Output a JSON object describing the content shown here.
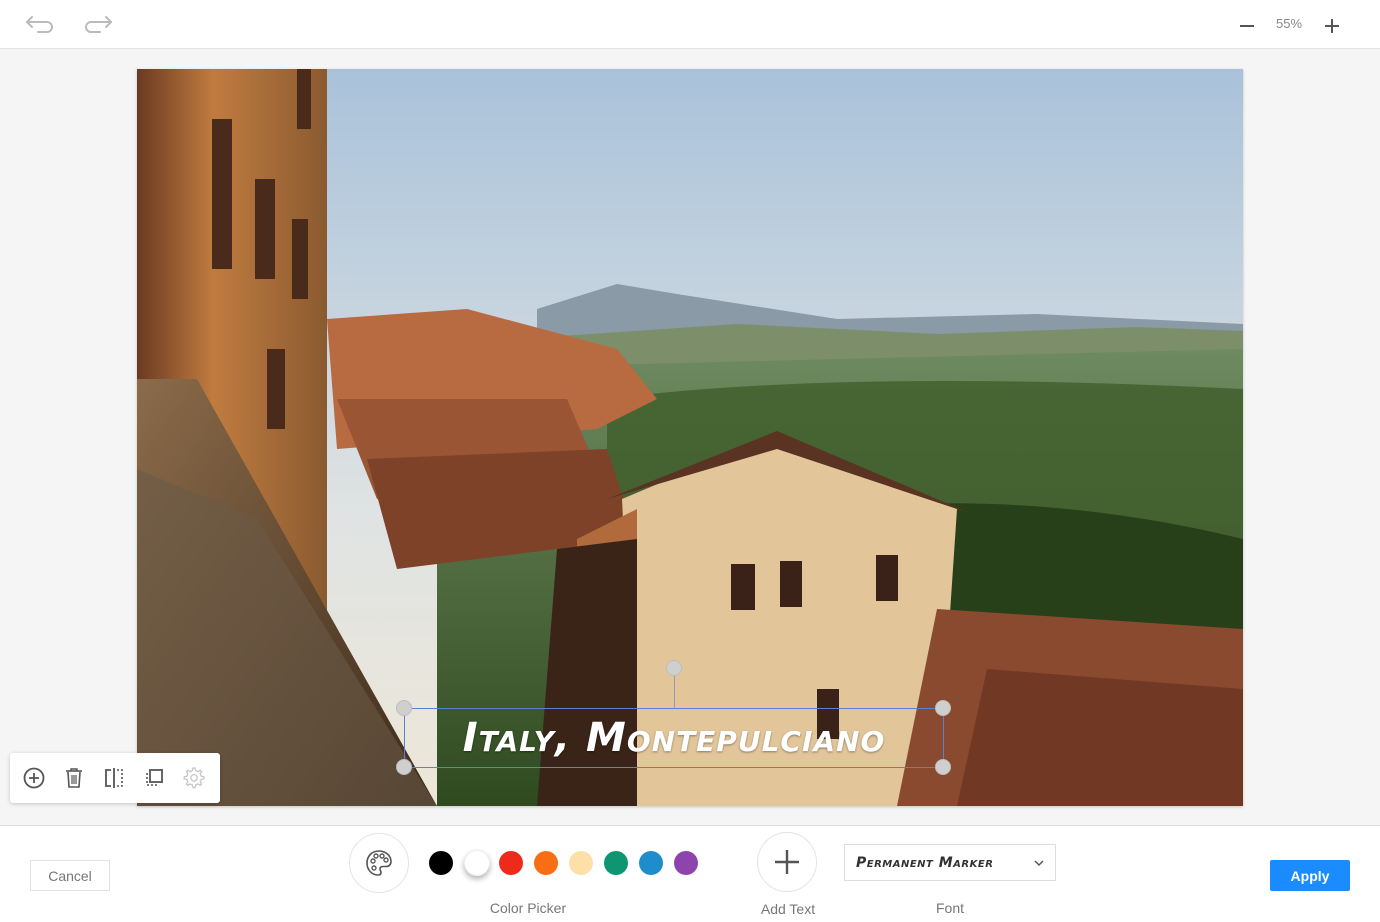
{
  "topbar": {
    "undo_icon": "undo-icon",
    "redo_icon": "redo-icon",
    "zoom_out_icon": "minus-icon",
    "zoom_in_icon": "plus-icon",
    "zoom_level": "55%"
  },
  "canvas": {
    "image_description": "Sunlit street of Montepulciano, Italy with terracotta roofs and Tuscan hills",
    "overlay_text": "Italy, Montepulciano",
    "overlay_text_color": "#ffffff",
    "selection_color": "#5b7fd6"
  },
  "floating_tools": {
    "items": [
      {
        "name": "add-icon",
        "label": "Add"
      },
      {
        "name": "trash-icon",
        "label": "Delete"
      },
      {
        "name": "flip-icon",
        "label": "Flip"
      },
      {
        "name": "duplicate-icon",
        "label": "Duplicate"
      },
      {
        "name": "gear-icon",
        "label": "Settings",
        "disabled": true
      }
    ]
  },
  "bottombar": {
    "cancel_label": "Cancel",
    "apply_label": "Apply",
    "color_picker_label": "Color Picker",
    "add_text_label": "Add Text",
    "font_label": "Font",
    "font_value": "Permanent Marker",
    "selected_color": "#ffffff",
    "colors": [
      "#000000",
      "#ffffff",
      "#ee2a1a",
      "#f96d14",
      "#fde0a6",
      "#0d9670",
      "#1f8ccb",
      "#8e44ad"
    ],
    "accent": "#1a8cff"
  }
}
